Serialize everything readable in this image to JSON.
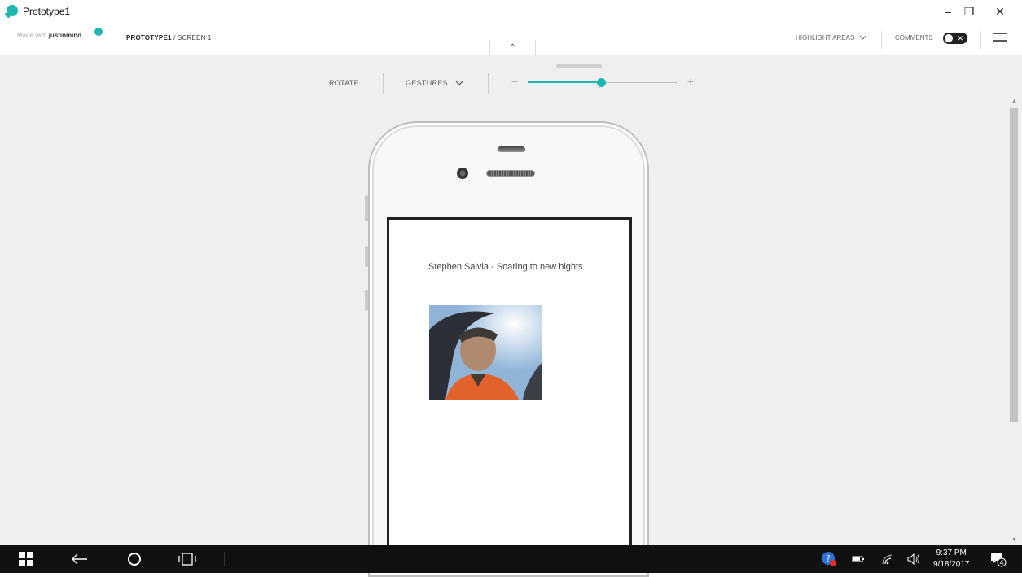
{
  "window": {
    "title": "Prototype1",
    "minimize_glyph": "–",
    "restore_glyph": "❐",
    "close_glyph": "✕"
  },
  "header": {
    "made_with_prefix": "Made with",
    "made_with_brand": "justinmind",
    "breadcrumb_project": "PROTOTYPE1",
    "breadcrumb_screen": " / SCREEN 1",
    "collapse_glyph": "⌃",
    "highlight_areas": "HIGHLIGHT AREAS",
    "comments": "COMMENTS",
    "comments_toggle_glyph": "✕"
  },
  "toolbar": {
    "rotate": "ROTATE",
    "gestures": "GESTURES",
    "zoom_minus": "−",
    "zoom_plus": "+",
    "zoom_level_fraction": 0.49
  },
  "screen": {
    "title": "Stephen Salvia  - Soaring to new hights"
  },
  "taskbar": {
    "time": "9:37 PM",
    "date": "9/18/2017",
    "notification_count": "4"
  },
  "colors": {
    "accent": "#1fb5b0",
    "canvas": "#efefef",
    "taskbar": "#101010"
  }
}
